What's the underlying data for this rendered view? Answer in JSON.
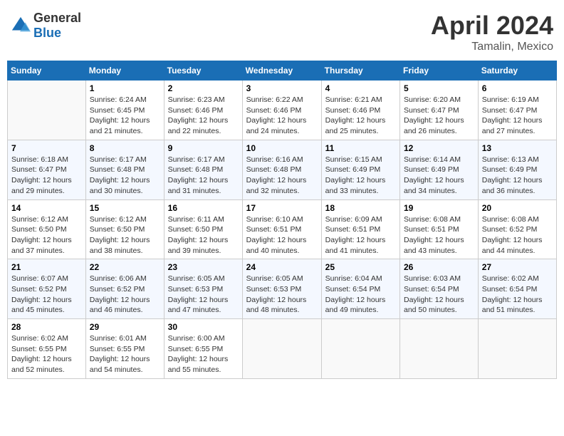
{
  "header": {
    "logo_general": "General",
    "logo_blue": "Blue",
    "month": "April 2024",
    "location": "Tamalin, Mexico"
  },
  "weekdays": [
    "Sunday",
    "Monday",
    "Tuesday",
    "Wednesday",
    "Thursday",
    "Friday",
    "Saturday"
  ],
  "weeks": [
    [
      {
        "day": "",
        "info": ""
      },
      {
        "day": "1",
        "info": "Sunrise: 6:24 AM\nSunset: 6:45 PM\nDaylight: 12 hours\nand 21 minutes."
      },
      {
        "day": "2",
        "info": "Sunrise: 6:23 AM\nSunset: 6:46 PM\nDaylight: 12 hours\nand 22 minutes."
      },
      {
        "day": "3",
        "info": "Sunrise: 6:22 AM\nSunset: 6:46 PM\nDaylight: 12 hours\nand 24 minutes."
      },
      {
        "day": "4",
        "info": "Sunrise: 6:21 AM\nSunset: 6:46 PM\nDaylight: 12 hours\nand 25 minutes."
      },
      {
        "day": "5",
        "info": "Sunrise: 6:20 AM\nSunset: 6:47 PM\nDaylight: 12 hours\nand 26 minutes."
      },
      {
        "day": "6",
        "info": "Sunrise: 6:19 AM\nSunset: 6:47 PM\nDaylight: 12 hours\nand 27 minutes."
      }
    ],
    [
      {
        "day": "7",
        "info": "Sunrise: 6:18 AM\nSunset: 6:47 PM\nDaylight: 12 hours\nand 29 minutes."
      },
      {
        "day": "8",
        "info": "Sunrise: 6:17 AM\nSunset: 6:48 PM\nDaylight: 12 hours\nand 30 minutes."
      },
      {
        "day": "9",
        "info": "Sunrise: 6:17 AM\nSunset: 6:48 PM\nDaylight: 12 hours\nand 31 minutes."
      },
      {
        "day": "10",
        "info": "Sunrise: 6:16 AM\nSunset: 6:48 PM\nDaylight: 12 hours\nand 32 minutes."
      },
      {
        "day": "11",
        "info": "Sunrise: 6:15 AM\nSunset: 6:49 PM\nDaylight: 12 hours\nand 33 minutes."
      },
      {
        "day": "12",
        "info": "Sunrise: 6:14 AM\nSunset: 6:49 PM\nDaylight: 12 hours\nand 34 minutes."
      },
      {
        "day": "13",
        "info": "Sunrise: 6:13 AM\nSunset: 6:49 PM\nDaylight: 12 hours\nand 36 minutes."
      }
    ],
    [
      {
        "day": "14",
        "info": "Sunrise: 6:12 AM\nSunset: 6:50 PM\nDaylight: 12 hours\nand 37 minutes."
      },
      {
        "day": "15",
        "info": "Sunrise: 6:12 AM\nSunset: 6:50 PM\nDaylight: 12 hours\nand 38 minutes."
      },
      {
        "day": "16",
        "info": "Sunrise: 6:11 AM\nSunset: 6:50 PM\nDaylight: 12 hours\nand 39 minutes."
      },
      {
        "day": "17",
        "info": "Sunrise: 6:10 AM\nSunset: 6:51 PM\nDaylight: 12 hours\nand 40 minutes."
      },
      {
        "day": "18",
        "info": "Sunrise: 6:09 AM\nSunset: 6:51 PM\nDaylight: 12 hours\nand 41 minutes."
      },
      {
        "day": "19",
        "info": "Sunrise: 6:08 AM\nSunset: 6:51 PM\nDaylight: 12 hours\nand 43 minutes."
      },
      {
        "day": "20",
        "info": "Sunrise: 6:08 AM\nSunset: 6:52 PM\nDaylight: 12 hours\nand 44 minutes."
      }
    ],
    [
      {
        "day": "21",
        "info": "Sunrise: 6:07 AM\nSunset: 6:52 PM\nDaylight: 12 hours\nand 45 minutes."
      },
      {
        "day": "22",
        "info": "Sunrise: 6:06 AM\nSunset: 6:52 PM\nDaylight: 12 hours\nand 46 minutes."
      },
      {
        "day": "23",
        "info": "Sunrise: 6:05 AM\nSunset: 6:53 PM\nDaylight: 12 hours\nand 47 minutes."
      },
      {
        "day": "24",
        "info": "Sunrise: 6:05 AM\nSunset: 6:53 PM\nDaylight: 12 hours\nand 48 minutes."
      },
      {
        "day": "25",
        "info": "Sunrise: 6:04 AM\nSunset: 6:54 PM\nDaylight: 12 hours\nand 49 minutes."
      },
      {
        "day": "26",
        "info": "Sunrise: 6:03 AM\nSunset: 6:54 PM\nDaylight: 12 hours\nand 50 minutes."
      },
      {
        "day": "27",
        "info": "Sunrise: 6:02 AM\nSunset: 6:54 PM\nDaylight: 12 hours\nand 51 minutes."
      }
    ],
    [
      {
        "day": "28",
        "info": "Sunrise: 6:02 AM\nSunset: 6:55 PM\nDaylight: 12 hours\nand 52 minutes."
      },
      {
        "day": "29",
        "info": "Sunrise: 6:01 AM\nSunset: 6:55 PM\nDaylight: 12 hours\nand 54 minutes."
      },
      {
        "day": "30",
        "info": "Sunrise: 6:00 AM\nSunset: 6:55 PM\nDaylight: 12 hours\nand 55 minutes."
      },
      {
        "day": "",
        "info": ""
      },
      {
        "day": "",
        "info": ""
      },
      {
        "day": "",
        "info": ""
      },
      {
        "day": "",
        "info": ""
      }
    ]
  ]
}
